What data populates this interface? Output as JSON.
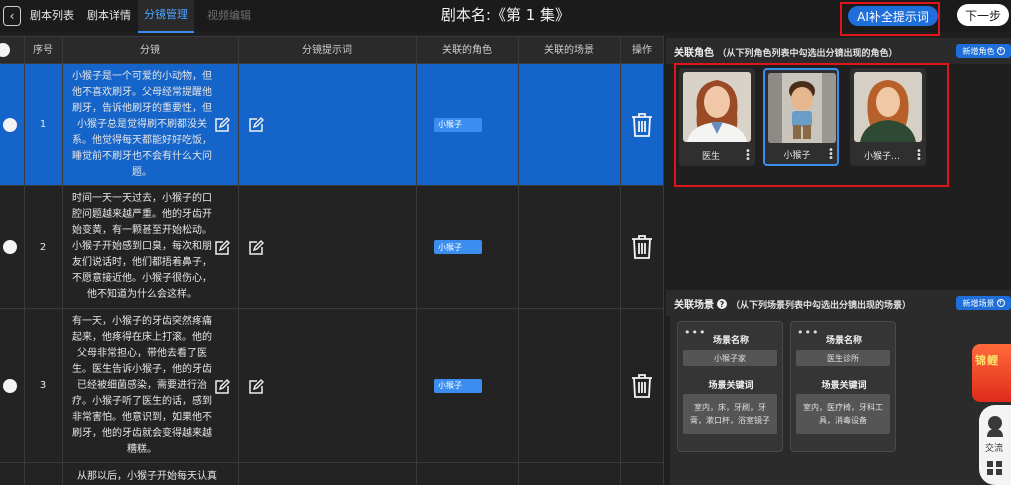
{
  "nav": {
    "back_symbol": "‹",
    "tabs": [
      {
        "label": "剧本列表",
        "state": "normal"
      },
      {
        "label": "剧本详情",
        "state": "normal"
      },
      {
        "label": "分镜管理",
        "state": "active"
      },
      {
        "label": "视频编辑",
        "state": "disabled"
      }
    ]
  },
  "header": {
    "title": "剧本名:《第 1 集》",
    "ai_button": "AI补全提示词",
    "next_button": "下一步"
  },
  "table": {
    "columns": [
      "序号",
      "分镜",
      "分镜提示词",
      "关联的角色",
      "关联的场景",
      "操作"
    ],
    "rows": [
      {
        "index": "1",
        "text": "小猴子是一个可爱的小动物，但他不喜欢刷牙。父母经常提醒他刷牙，告诉他刷牙的重要性，但小猴子总是觉得刷不刷都没关系。他觉得每天都能好好吃饭，睡觉前不刷牙也不会有什么大问题。",
        "role": "小猴子",
        "selected": true
      },
      {
        "index": "2",
        "text": "时间一天一天过去，小猴子的口腔问题越来越严重。他的牙齿开始变黄，有一颗甚至开始松动。小猴子开始感到口臭，每次和朋友们说话时，他们都捂着鼻子，不愿意接近他。小猴子很伤心，他不知道为什么会这样。",
        "role": "小猴子",
        "selected": false
      },
      {
        "index": "3",
        "text": "有一天，小猴子的牙齿突然疼痛起来，他疼得在床上打滚。他的父母非常担心，带他去看了医生。医生告诉小猴子，他的牙齿已经被细菌感染，需要进行治疗。小猴子听了医生的话，感到非常害怕。他意识到，如果他不刷牙，他的牙齿就会变得越来越糟糕。",
        "role": "小猴子",
        "selected": false
      },
      {
        "index": "",
        "text": "从那以后，小猴子开始每天认真",
        "role": "",
        "selected": false
      }
    ]
  },
  "roles_section": {
    "title": "关联角色",
    "subtitle": "（从下列角色列表中勾选出分镜出现的角色）",
    "new_button": "新增角色",
    "cards": [
      {
        "name": "医生",
        "selected": false
      },
      {
        "name": "小猴子",
        "selected": true
      },
      {
        "name": "小猴子…",
        "selected": false
      }
    ]
  },
  "scenes_section": {
    "title": "关联场景",
    "subtitle": "（从下列场景列表中勾选出分镜出现的场景）",
    "new_button": "新增场景",
    "cards": [
      {
        "name_label": "场景名称",
        "name": "小猴子家",
        "keyword_label": "场景关键词",
        "keywords": "室内，床，牙刷，牙膏，漱口杯，浴室镜子"
      },
      {
        "name_label": "场景名称",
        "name": "医生诊所",
        "keyword_label": "场景关键词",
        "keywords": "室内，医疗椅，牙科工具，消毒设备"
      }
    ]
  },
  "side_widgets": {
    "promo_text": "锦鲤",
    "chat_label": "交流"
  },
  "colors": {
    "accent": "#1e6fd9",
    "selected_row": "#1564c9",
    "highlight_outline": "#e0141c",
    "background": "#1f1f1f"
  }
}
